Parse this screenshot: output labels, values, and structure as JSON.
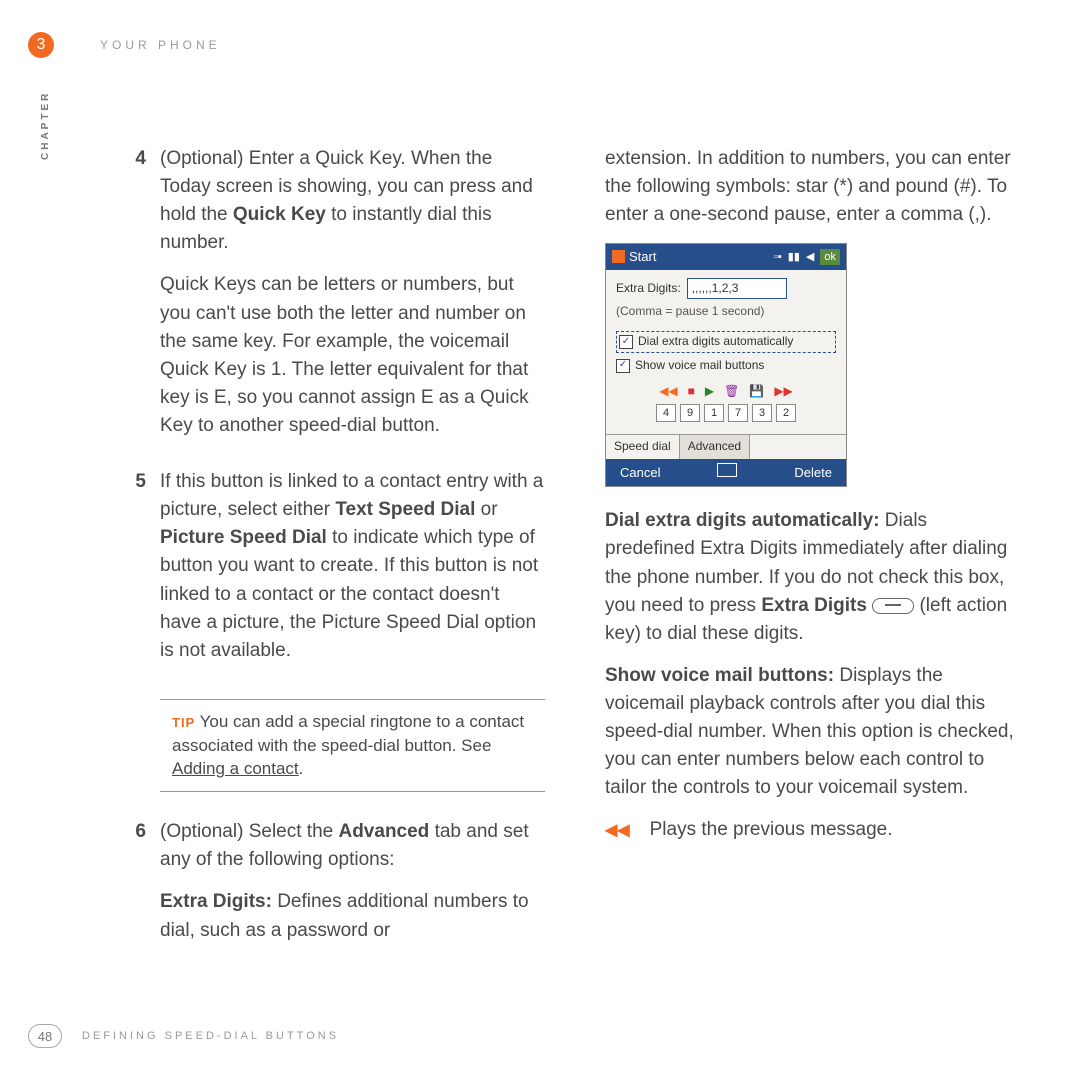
{
  "header": {
    "chapter_num": "3",
    "chapter_title": "YOUR PHONE",
    "sidebar": "CHAPTER"
  },
  "footer": {
    "page_num": "48",
    "section": "DEFINING SPEED-DIAL BUTTONS"
  },
  "left": {
    "s4_num": "4",
    "s4_a1": "(Optional) Enter a Quick Key. When the Today screen is showing, you can press and hold the ",
    "s4_bold": "Quick Key",
    "s4_a2": " to instantly dial this number.",
    "s4_b": "Quick Keys can be letters or numbers, but you can't use both the letter and number on the same key. For example, the voicemail Quick Key is 1. The letter equivalent for that key is E, so you cannot assign E as a Quick Key to another speed-dial button.",
    "s5_num": "5",
    "s5_a": "If this button is linked to a contact entry with a picture, select either ",
    "s5_b1": "Text Speed Dial",
    "s5_c": " or ",
    "s5_b2": "Picture Speed Dial",
    "s5_d": " to indicate which type of button you want to create. If this button is not linked to a contact or the contact doesn't have a picture, the Picture Speed Dial option is not available.",
    "tip_label": "TIP",
    "tip_a": " You can add a special ringtone to a contact associated with the speed-dial button. See ",
    "tip_link": "Adding a contact",
    "tip_b": ".",
    "s6_num": "6",
    "s6_a": "(Optional) Select the ",
    "s6_bold": "Advanced",
    "s6_b": " tab and set any of the following options:",
    "s6_extra_bold": "Extra Digits:",
    "s6_extra_txt": " Defines additional numbers to dial, such as a password or "
  },
  "right": {
    "cont": "extension. In addition to numbers, you can enter the following symbols: star (*) and pound (#). To enter a one-second pause, enter a comma (,).",
    "dial_bold": "Dial extra digits automatically:",
    "dial_txt": " Dials predefined Extra Digits immediately after dialing the phone number. If you do not check this box, you need to press ",
    "dial_extra_bold": "Extra Digits",
    "dial_txt2": " (left action key) to dial these digits.",
    "show_bold": "Show voice mail buttons:",
    "show_txt": " Displays the voicemail playback controls after you dial this speed-dial number. When this option is checked, you can enter numbers below each control to tailor the controls to your voicemail system.",
    "prev_msg": "Plays the previous message."
  },
  "shot": {
    "title": "Start",
    "ok": "ok",
    "extra_label": "Extra Digits:",
    "extra_value": ",,,,,,1,2,3",
    "hint": "(Comma = pause 1 second)",
    "chk1": "Dial extra digits automatically",
    "chk2": "Show voice mail buttons",
    "nums": [
      "4",
      "9",
      "1",
      "7",
      "3",
      "2"
    ],
    "tab1": "Speed dial",
    "tab2": "Advanced",
    "f_cancel": "Cancel",
    "f_delete": "Delete"
  }
}
